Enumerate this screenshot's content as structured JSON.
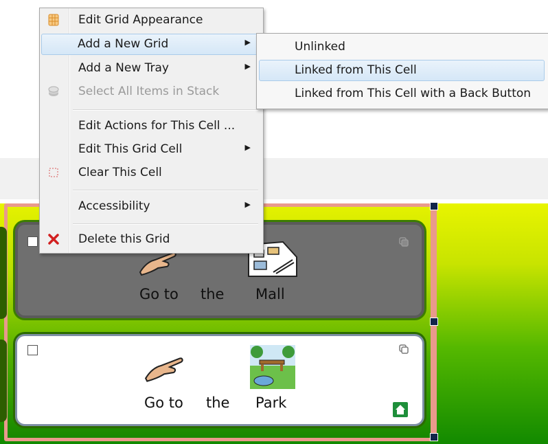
{
  "context_menu": {
    "items": [
      {
        "label": "Edit Grid Appearance",
        "icon": "grid-appearance-icon",
        "has_submenu": false,
        "enabled": true
      },
      {
        "label": "Add a New Grid",
        "icon": "",
        "has_submenu": true,
        "enabled": true,
        "highlighted": true
      },
      {
        "label": "Add a New Tray",
        "icon": "",
        "has_submenu": true,
        "enabled": true
      },
      {
        "label": "Select All Items in Stack",
        "icon": "stack-icon",
        "has_submenu": false,
        "enabled": false
      },
      {
        "label": "Edit Actions for This Cell ...",
        "icon": "",
        "has_submenu": false,
        "enabled": true
      },
      {
        "label": "Edit This Grid Cell",
        "icon": "",
        "has_submenu": true,
        "enabled": true
      },
      {
        "label": "Clear This Cell",
        "icon": "clear-cell-icon",
        "has_submenu": false,
        "enabled": true
      },
      {
        "label": "Accessibility",
        "icon": "",
        "has_submenu": true,
        "enabled": true
      },
      {
        "label": "Delete this Grid",
        "icon": "delete-x-icon",
        "has_submenu": false,
        "enabled": true
      }
    ],
    "submenu_arrow": "▶"
  },
  "submenu": {
    "items": [
      {
        "label": "Unlinked",
        "highlighted": false
      },
      {
        "label": "Linked from This Cell",
        "highlighted": true
      },
      {
        "label": "Linked from This Cell with a Back Button",
        "highlighted": false
      }
    ]
  },
  "cells": [
    {
      "words": [
        "Go to",
        "the",
        "Mall"
      ],
      "style": "dark",
      "symbols": [
        "pointing-hand-icon",
        "mall-icon"
      ]
    },
    {
      "words": [
        "Go to",
        "the",
        "Park"
      ],
      "style": "light",
      "symbols": [
        "pointing-hand-icon",
        "park-icon"
      ]
    }
  ],
  "colors": {
    "highlight": "#d5e7f7",
    "grid_border": "#e99a8c",
    "grid_gradient_top": "#e4f100",
    "grid_gradient_bottom": "#178800",
    "delete_icon": "#d22020",
    "home_button": "#1e8f3a"
  }
}
